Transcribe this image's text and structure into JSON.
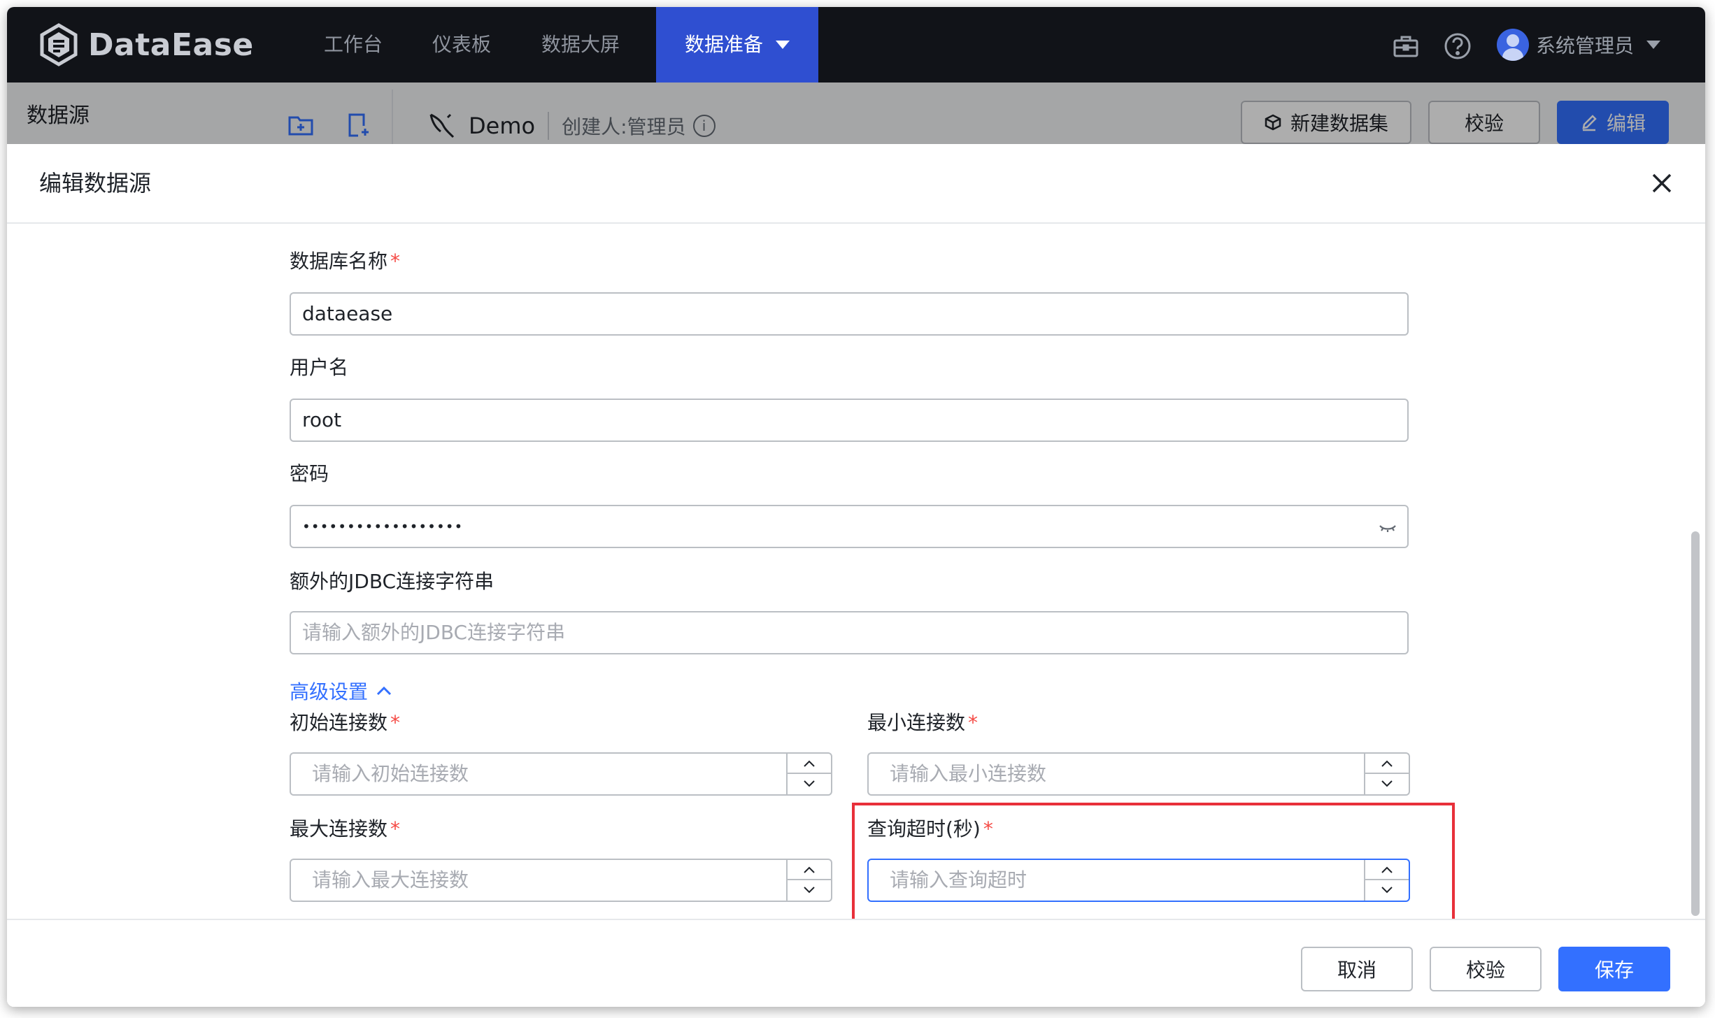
{
  "app": {
    "logo_text": "DataEase"
  },
  "nav": {
    "items": [
      {
        "label": "工作台"
      },
      {
        "label": "仪表板"
      },
      {
        "label": "数据大屏"
      },
      {
        "label": "数据准备"
      }
    ],
    "active_index": 3,
    "user_name": "系统管理员"
  },
  "subbar": {
    "title": "数据源",
    "datasource_name": "Demo",
    "creator": "创建人:管理员",
    "buttons": {
      "new_dataset": "新建数据集",
      "validate": "校验",
      "edit": "编辑"
    }
  },
  "drawer": {
    "title": "编辑数据源",
    "fields": {
      "db_name": {
        "label": "数据库名称",
        "value": "dataease",
        "required": true
      },
      "username": {
        "label": "用户名",
        "value": "root"
      },
      "password": {
        "label": "密码",
        "value": "••••••••••••••••••"
      },
      "jdbc": {
        "label": "额外的JDBC连接字符串",
        "placeholder": "请输入额外的JDBC连接字符串"
      }
    },
    "advanced_toggle": "高级设置",
    "advanced": {
      "init_conn": {
        "label": "初始连接数",
        "placeholder": "请输入初始连接数"
      },
      "min_conn": {
        "label": "最小连接数",
        "placeholder": "请输入最小连接数"
      },
      "max_conn": {
        "label": "最大连接数",
        "placeholder": "请输入最大连接数"
      },
      "query_timeout": {
        "label": "查询超时(秒)",
        "placeholder": "请输入查询超时"
      }
    },
    "footer": {
      "cancel": "取消",
      "validate": "校验",
      "save": "保存"
    }
  },
  "colors": {
    "accent": "#3370ff",
    "nav_bg": "#111318",
    "highlight_box": "#e8303a",
    "required": "#f54a45"
  },
  "icons": [
    "logo-icon",
    "toolbox-icon",
    "help-icon",
    "avatar",
    "folder-add-icon",
    "file-add-icon",
    "mysql-icon",
    "info-icon",
    "cube-icon",
    "edit-icon",
    "close-icon",
    "eye-closed-icon",
    "chevron-up-icon",
    "chevron-down-icon"
  ]
}
